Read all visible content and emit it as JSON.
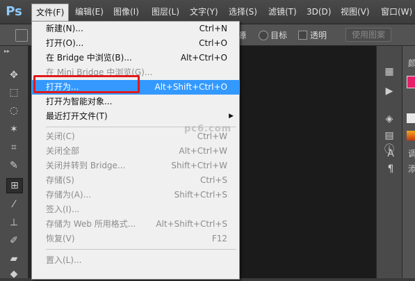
{
  "app": {
    "logo": "Ps"
  },
  "menubar": [
    {
      "label": "文件(F)",
      "open": true
    },
    {
      "label": "编辑(E)"
    },
    {
      "label": "图像(I)"
    },
    {
      "label": "图层(L)"
    },
    {
      "label": "文字(Y)"
    },
    {
      "label": "选择(S)"
    },
    {
      "label": "滤镜(T)"
    },
    {
      "label": "3D(D)"
    },
    {
      "label": "视图(V)"
    },
    {
      "label": "窗口(W)"
    }
  ],
  "options_bar": {
    "partial_label": "源",
    "target_label": "目标",
    "transparent_label": "透明",
    "use_pattern_label": "使用图案"
  },
  "file_menu": {
    "items": [
      {
        "label": "新建(N)...",
        "shortcut": "Ctrl+N",
        "disabled": false
      },
      {
        "label": "打开(O)...",
        "shortcut": "Ctrl+O",
        "disabled": false
      },
      {
        "label": "在 Bridge 中浏览(B)...",
        "shortcut": "Alt+Ctrl+O",
        "disabled": false
      },
      {
        "label": "在 Mini Bridge 中浏览(G)...",
        "shortcut": "",
        "disabled": true
      },
      {
        "label": "打开为...",
        "shortcut": "Alt+Shift+Ctrl+O",
        "disabled": false,
        "highlight": true
      },
      {
        "label": "打开为智能对象...",
        "shortcut": "",
        "disabled": false
      },
      {
        "label": "最近打开文件(T)",
        "shortcut": "",
        "disabled": false,
        "submenu": true
      },
      {
        "label": "关闭(C)",
        "shortcut": "Ctrl+W",
        "disabled": true
      },
      {
        "label": "关闭全部",
        "shortcut": "Alt+Ctrl+W",
        "disabled": true
      },
      {
        "label": "关闭并转到 Bridge...",
        "shortcut": "Shift+Ctrl+W",
        "disabled": true
      },
      {
        "label": "存储(S)",
        "shortcut": "Ctrl+S",
        "disabled": true
      },
      {
        "label": "存储为(A)...",
        "shortcut": "Shift+Ctrl+S",
        "disabled": true
      },
      {
        "label": "签入(I)...",
        "shortcut": "",
        "disabled": true
      },
      {
        "label": "存储为 Web 所用格式...",
        "shortcut": "Alt+Shift+Ctrl+S",
        "disabled": true
      },
      {
        "label": "恢复(V)",
        "shortcut": "F12",
        "disabled": true
      },
      {
        "label": "置入(L)...",
        "shortcut": "",
        "disabled": true
      }
    ],
    "submenu_arrow": "▶"
  },
  "right_panel": {
    "color_tab_partial": "颜",
    "adjust_partial": "调",
    "add_partial": "添"
  },
  "watermark": "pc6.com",
  "colors": {
    "highlight": "#3399ff",
    "annotation_box": "#e0191b",
    "foreground_swatch": "#e8206a",
    "ps_logo": "#8ecbff"
  }
}
